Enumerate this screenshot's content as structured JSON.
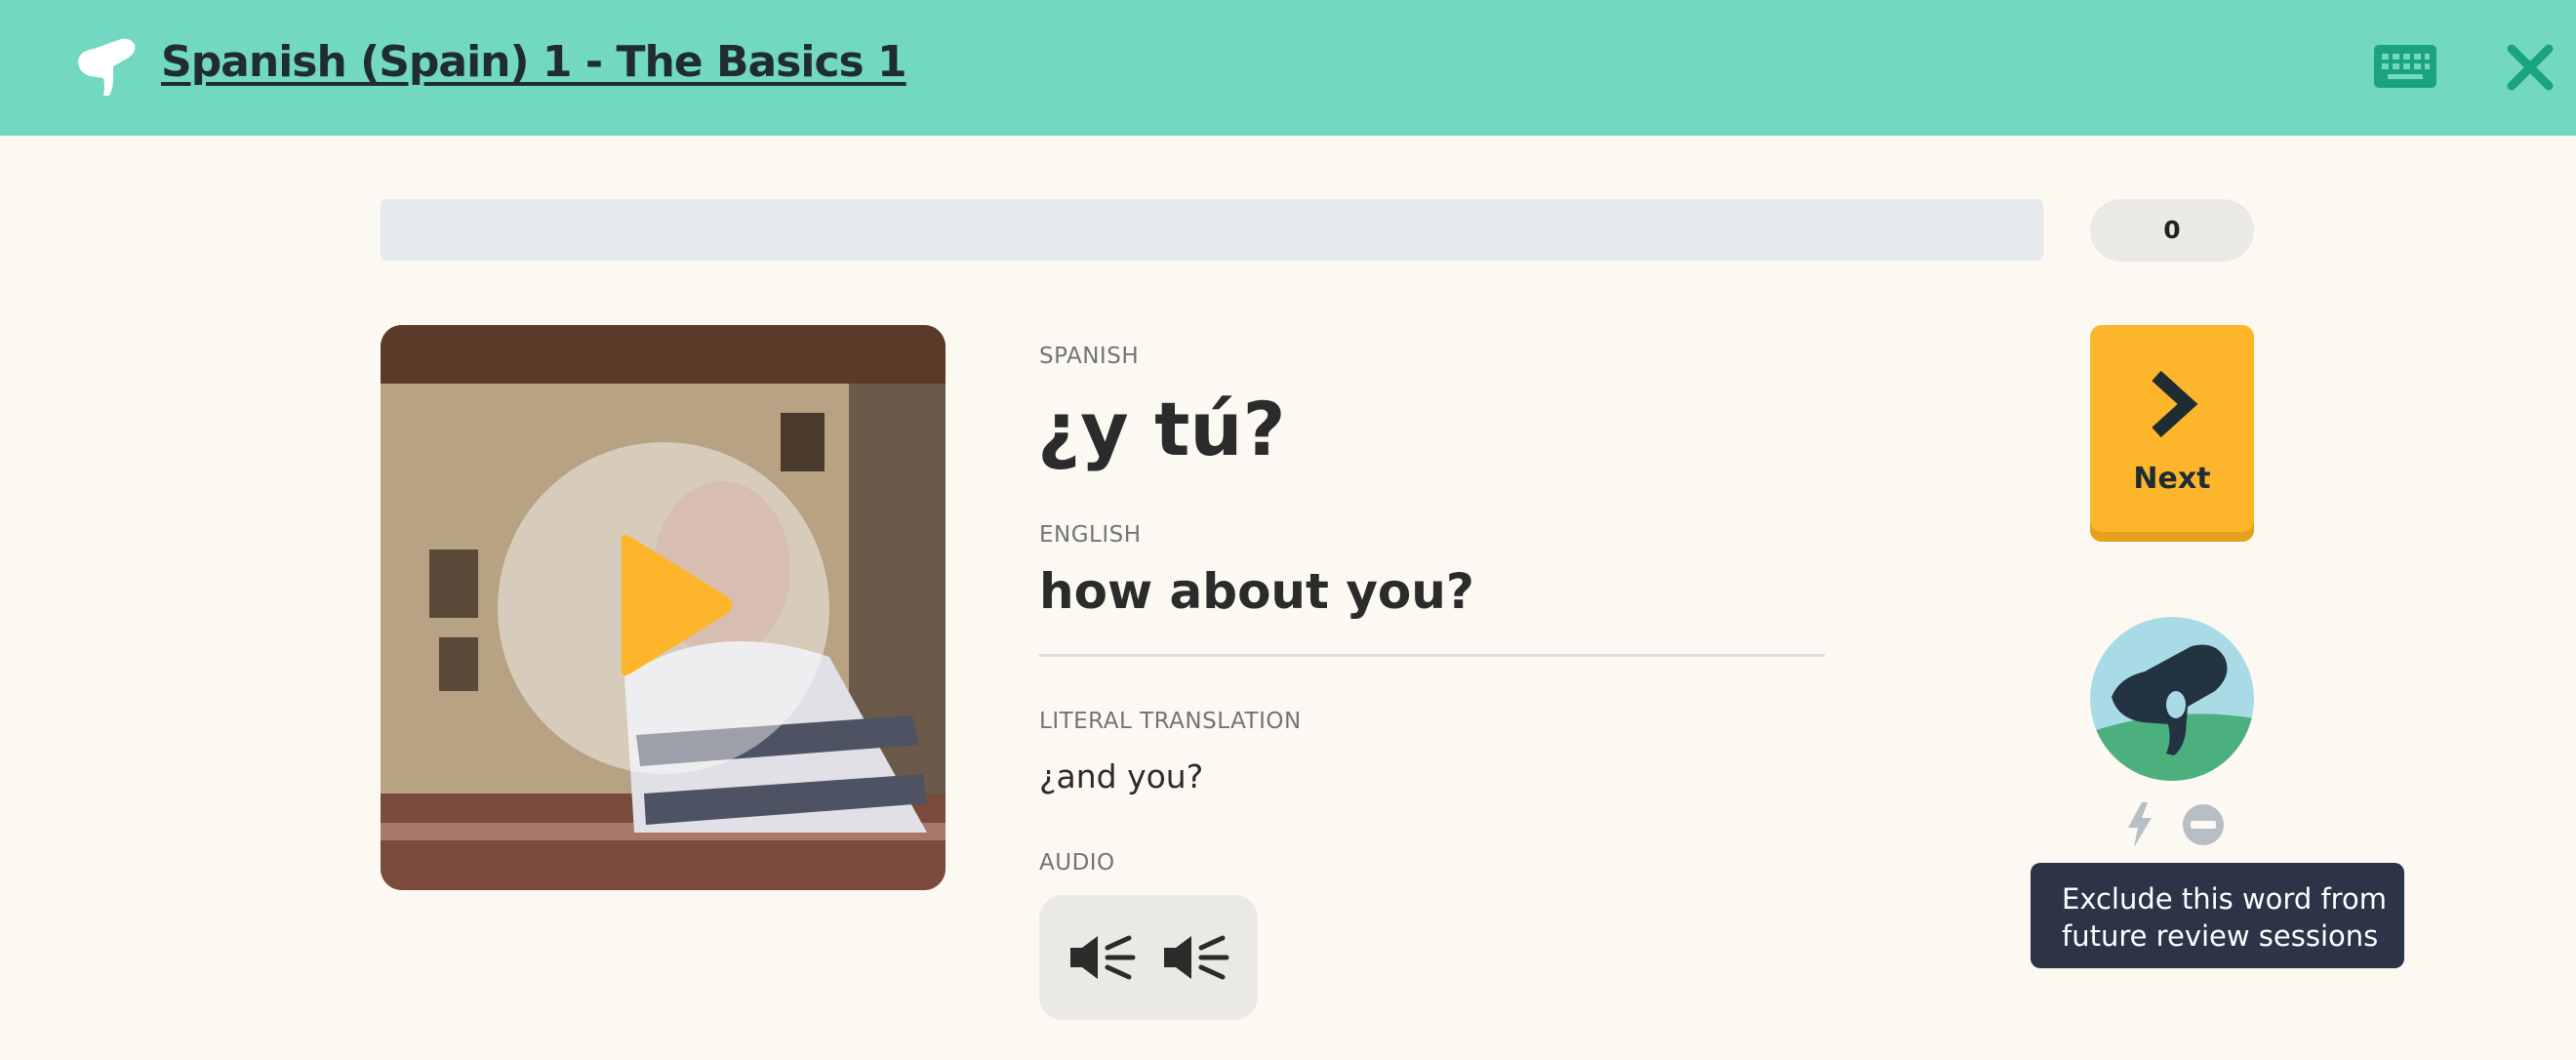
{
  "header": {
    "course_title": "Spanish (Spain) 1 - The Basics 1",
    "logo_icon": "hand-logo-icon",
    "keyboard_icon": "keyboard-icon",
    "close_icon": "close-icon",
    "background_color": "#72d8c2"
  },
  "progress": {
    "fraction": 0,
    "score": "0"
  },
  "video": {
    "icon": "play-icon",
    "accent": "#fdb62b"
  },
  "card": {
    "spanish_label": "SPANISH",
    "spanish_word": "¿y tú?",
    "english_label": "ENGLISH",
    "english_word": "how about you?",
    "literal_label": "LITERAL TRANSLATION",
    "literal_text": "¿and you?",
    "audio_label": "AUDIO",
    "audio_icons": [
      "speaker-icon",
      "speaker-icon"
    ]
  },
  "next_button": {
    "label": "Next",
    "icon": "chevron-right-icon",
    "color": "#fdb62b"
  },
  "side": {
    "avatar_icon": "mascot-avatar-icon",
    "bolt_icon": "bolt-icon",
    "exclude_icon": "exclude-icon",
    "tooltip": "Exclude this word from future review sessions"
  }
}
